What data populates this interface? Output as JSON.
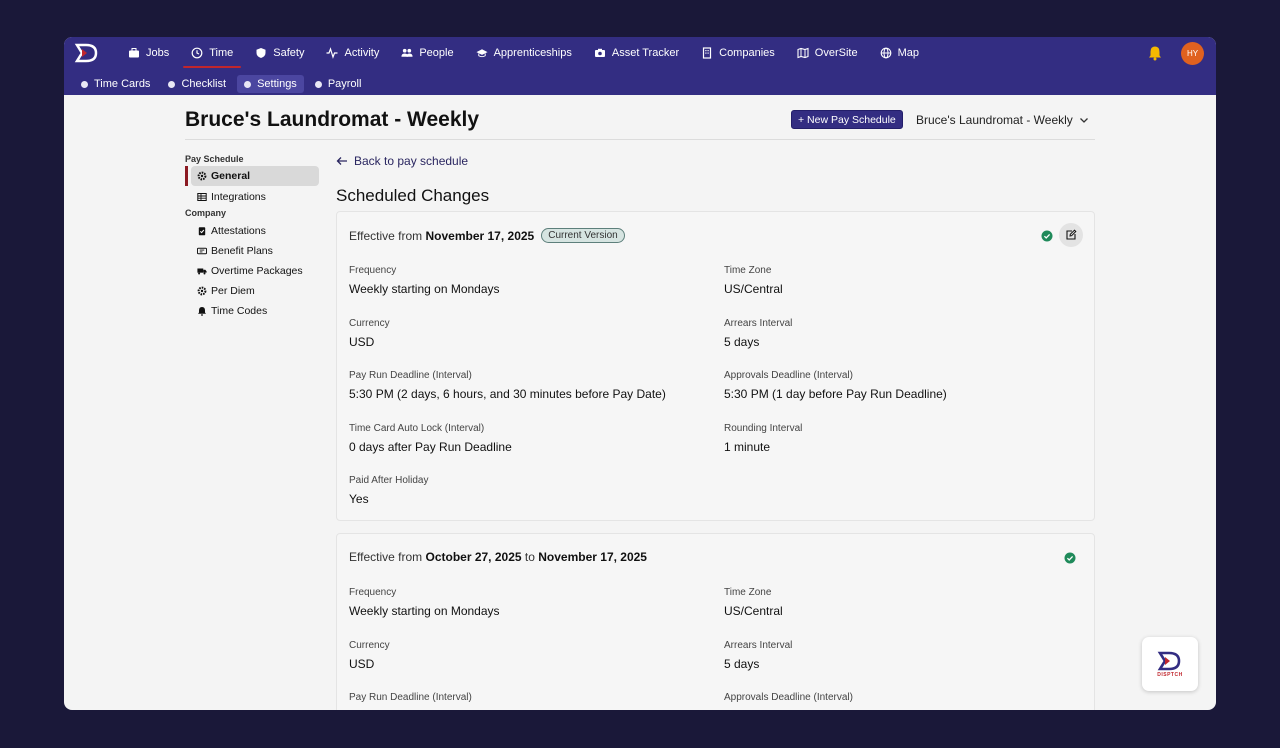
{
  "nav": {
    "items": [
      {
        "label": "Jobs",
        "icon": "briefcase-icon"
      },
      {
        "label": "Time",
        "icon": "clock-icon"
      },
      {
        "label": "Safety",
        "icon": "shield-icon"
      },
      {
        "label": "Activity",
        "icon": "pulse-icon"
      },
      {
        "label": "People",
        "icon": "people-icon"
      },
      {
        "label": "Apprenticeships",
        "icon": "graduation-cap-icon"
      },
      {
        "label": "Asset Tracker",
        "icon": "camera-icon"
      },
      {
        "label": "Companies",
        "icon": "building-icon"
      },
      {
        "label": "OverSite",
        "icon": "map-folded-icon"
      },
      {
        "label": "Map",
        "icon": "globe-icon"
      }
    ],
    "active": "Time",
    "avatar_initials": "HY"
  },
  "subnav": {
    "items": [
      {
        "label": "Time Cards"
      },
      {
        "label": "Checklist"
      },
      {
        "label": "Settings"
      },
      {
        "label": "Payroll"
      }
    ],
    "active": "Settings"
  },
  "page": {
    "title": "Bruce's Laundromat - Weekly",
    "new_button": "+ New Pay Schedule",
    "schedule_select": "Bruce's Laundromat - Weekly"
  },
  "sidebar": {
    "pay_schedule_heading": "Pay Schedule",
    "pay_schedule_items": [
      {
        "label": "General",
        "icon": "gear-icon"
      },
      {
        "label": "Integrations",
        "icon": "table-icon"
      }
    ],
    "company_heading": "Company",
    "company_items": [
      {
        "label": "Attestations",
        "icon": "clipboard-check-icon"
      },
      {
        "label": "Benefit Plans",
        "icon": "ticket-icon"
      },
      {
        "label": "Overtime Packages",
        "icon": "truck-icon"
      },
      {
        "label": "Per Diem",
        "icon": "gear-icon"
      },
      {
        "label": "Time Codes",
        "icon": "bell-icon"
      }
    ]
  },
  "main": {
    "back_link": "Back to pay schedule",
    "section_title": "Scheduled Changes",
    "cards": [
      {
        "prefix": "Effective from",
        "start": "November 17, 2025",
        "badge": "Current Version",
        "fields": [
          {
            "label": "Frequency",
            "value": "Weekly starting on Mondays"
          },
          {
            "label": "Time Zone",
            "value": "US/Central"
          },
          {
            "label": "Currency",
            "value": "USD"
          },
          {
            "label": "Arrears Interval",
            "value": "5 days"
          },
          {
            "label": "Pay Run Deadline (Interval)",
            "value": "5:30 PM (2 days, 6 hours, and 30 minutes before Pay Date)"
          },
          {
            "label": "Approvals Deadline (Interval)",
            "value": "5:30 PM (1 day before Pay Run Deadline)"
          },
          {
            "label": "Time Card Auto Lock (Interval)",
            "value": "0 days after Pay Run Deadline"
          },
          {
            "label": "Rounding Interval",
            "value": "1 minute"
          },
          {
            "label": "Paid After Holiday",
            "value": "Yes"
          }
        ]
      },
      {
        "prefix": "Effective from",
        "start": "October 27, 2025",
        "joiner": "to",
        "end": "November 17, 2025",
        "fields": [
          {
            "label": "Frequency",
            "value": "Weekly starting on Mondays"
          },
          {
            "label": "Time Zone",
            "value": "US/Central"
          },
          {
            "label": "Currency",
            "value": "USD"
          },
          {
            "label": "Arrears Interval",
            "value": "5 days"
          },
          {
            "label": "Pay Run Deadline (Interval)",
            "value": ""
          },
          {
            "label": "Approvals Deadline (Interval)",
            "value": ""
          }
        ]
      }
    ]
  },
  "fab": {
    "label": "DISPTCH"
  },
  "colors": {
    "nav_bg": "#332d82",
    "accent_red": "#c0262d",
    "success_green": "#1f8a5a",
    "bell_yellow": "#f5b800",
    "avatar_orange": "#e0611f"
  }
}
